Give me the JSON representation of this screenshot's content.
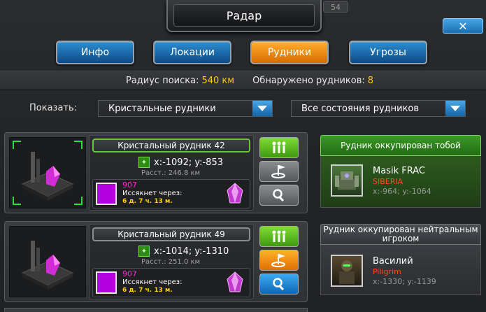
{
  "window": {
    "title": "Радар",
    "badge": "54",
    "close_glyph": "✕"
  },
  "tabs": [
    {
      "label": "Инфо",
      "active": false
    },
    {
      "label": "Локации",
      "active": false
    },
    {
      "label": "Рудники",
      "active": true
    },
    {
      "label": "Угрозы",
      "active": false
    }
  ],
  "info_bar": {
    "radius_label": "Радиус поиска:",
    "radius_value": "540 км",
    "found_label": "Обнаружено рудников:",
    "found_value": "8"
  },
  "filters": {
    "show_label": "Показать:",
    "type_selected": "Кристальные рудники",
    "state_selected": "Все состояния рудников"
  },
  "mines": [
    {
      "name": "Кристальный рудник 42",
      "coords": "x:-1092; y:-853",
      "distance": "Расст.: 246.8 км",
      "resource_count": "907",
      "expires_label": "Иссякнет через:",
      "expires_time": "6 д. 7 ч. 13 м.",
      "owner": {
        "status": "Рудник оккупирован тобой",
        "name": "Masik FRAC",
        "clan": "SIBERIA",
        "coords": "x:-964; y:-1064"
      }
    },
    {
      "name": "Кристальный рудник 49",
      "coords": "x:-1014; y:-1310",
      "distance": "Расст.: 251.0 км",
      "resource_count": "907",
      "expires_label": "Иссякнет через:",
      "expires_time": "6 д. 7 ч. 13 м.",
      "owner": {
        "status": "Рудник оккупирован нейтральным игроком",
        "name": "Василий",
        "clan": "Piligrim",
        "coords": "x:-1330; y:-1139"
      }
    }
  ],
  "colors": {
    "accent_yellow": "#ffcc00",
    "tab_blue": "#1b6fb3",
    "tab_active_orange": "#f08a10",
    "own_green": "#2f7a1e",
    "resource_purple": "#b300e0"
  }
}
